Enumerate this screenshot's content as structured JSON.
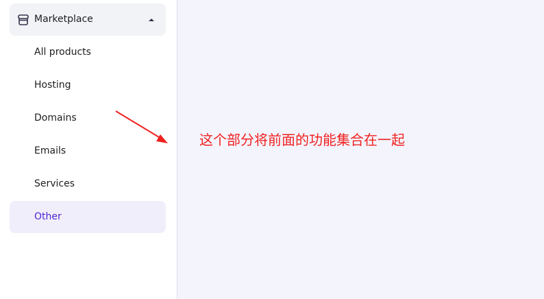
{
  "sidebar": {
    "group": {
      "label": "Marketplace",
      "icon": "storefront-icon",
      "expanded": true
    },
    "items": [
      {
        "label": "All products",
        "active": false
      },
      {
        "label": "Hosting",
        "active": false
      },
      {
        "label": "Domains",
        "active": false
      },
      {
        "label": "Emails",
        "active": false
      },
      {
        "label": "Services",
        "active": false
      },
      {
        "label": "Other",
        "active": true
      }
    ]
  },
  "annotation": {
    "text": "这个部分将前面的功能集合在一起",
    "color": "#f0211f"
  },
  "colors": {
    "accent": "#5025d1",
    "active_bg": "#f1eefc",
    "main_bg": "#f4f4fd",
    "header_bg": "#f2f3f6"
  }
}
